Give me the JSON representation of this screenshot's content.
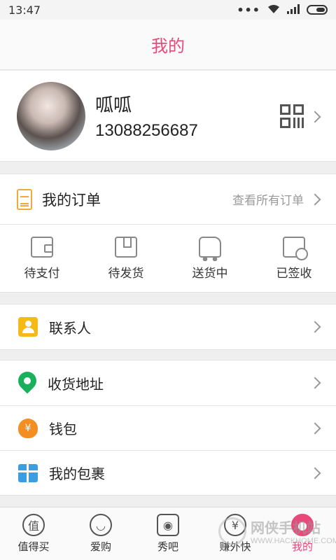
{
  "status_bar": {
    "time": "13:47",
    "signal": "•••"
  },
  "header": {
    "title": "我的"
  },
  "profile": {
    "name": "呱呱",
    "phone": "13088256687"
  },
  "orders": {
    "title": "我的订单",
    "view_all": "查看所有订单",
    "statuses": [
      {
        "label": "待支付",
        "icon": "wallet-icon"
      },
      {
        "label": "待发货",
        "icon": "box-icon"
      },
      {
        "label": "送货中",
        "icon": "truck-icon"
      },
      {
        "label": "已签收",
        "icon": "signed-icon"
      }
    ]
  },
  "menu": {
    "contacts": "联系人",
    "address": "收货地址",
    "wallet": "钱包",
    "wallet_symbol": "¥",
    "packages": "我的包裹"
  },
  "tabbar": {
    "items": [
      {
        "label": "值得买",
        "glyph": "值"
      },
      {
        "label": "爱购",
        "glyph": "◡"
      },
      {
        "label": "秀吧",
        "glyph": "◉"
      },
      {
        "label": "赚外快",
        "glyph": "¥"
      },
      {
        "label": "我的",
        "glyph": "●"
      }
    ],
    "active_color": "#e8497a"
  },
  "watermark": {
    "cn": "网侠手机站",
    "en": "WWW.HACKHOME.COM"
  },
  "colors": {
    "accent": "#e8497a",
    "order_icon": "#f0a93a",
    "contact": "#f5b919",
    "address": "#18b05d",
    "wallet": "#f28e22",
    "package": "#3b9ee2"
  }
}
